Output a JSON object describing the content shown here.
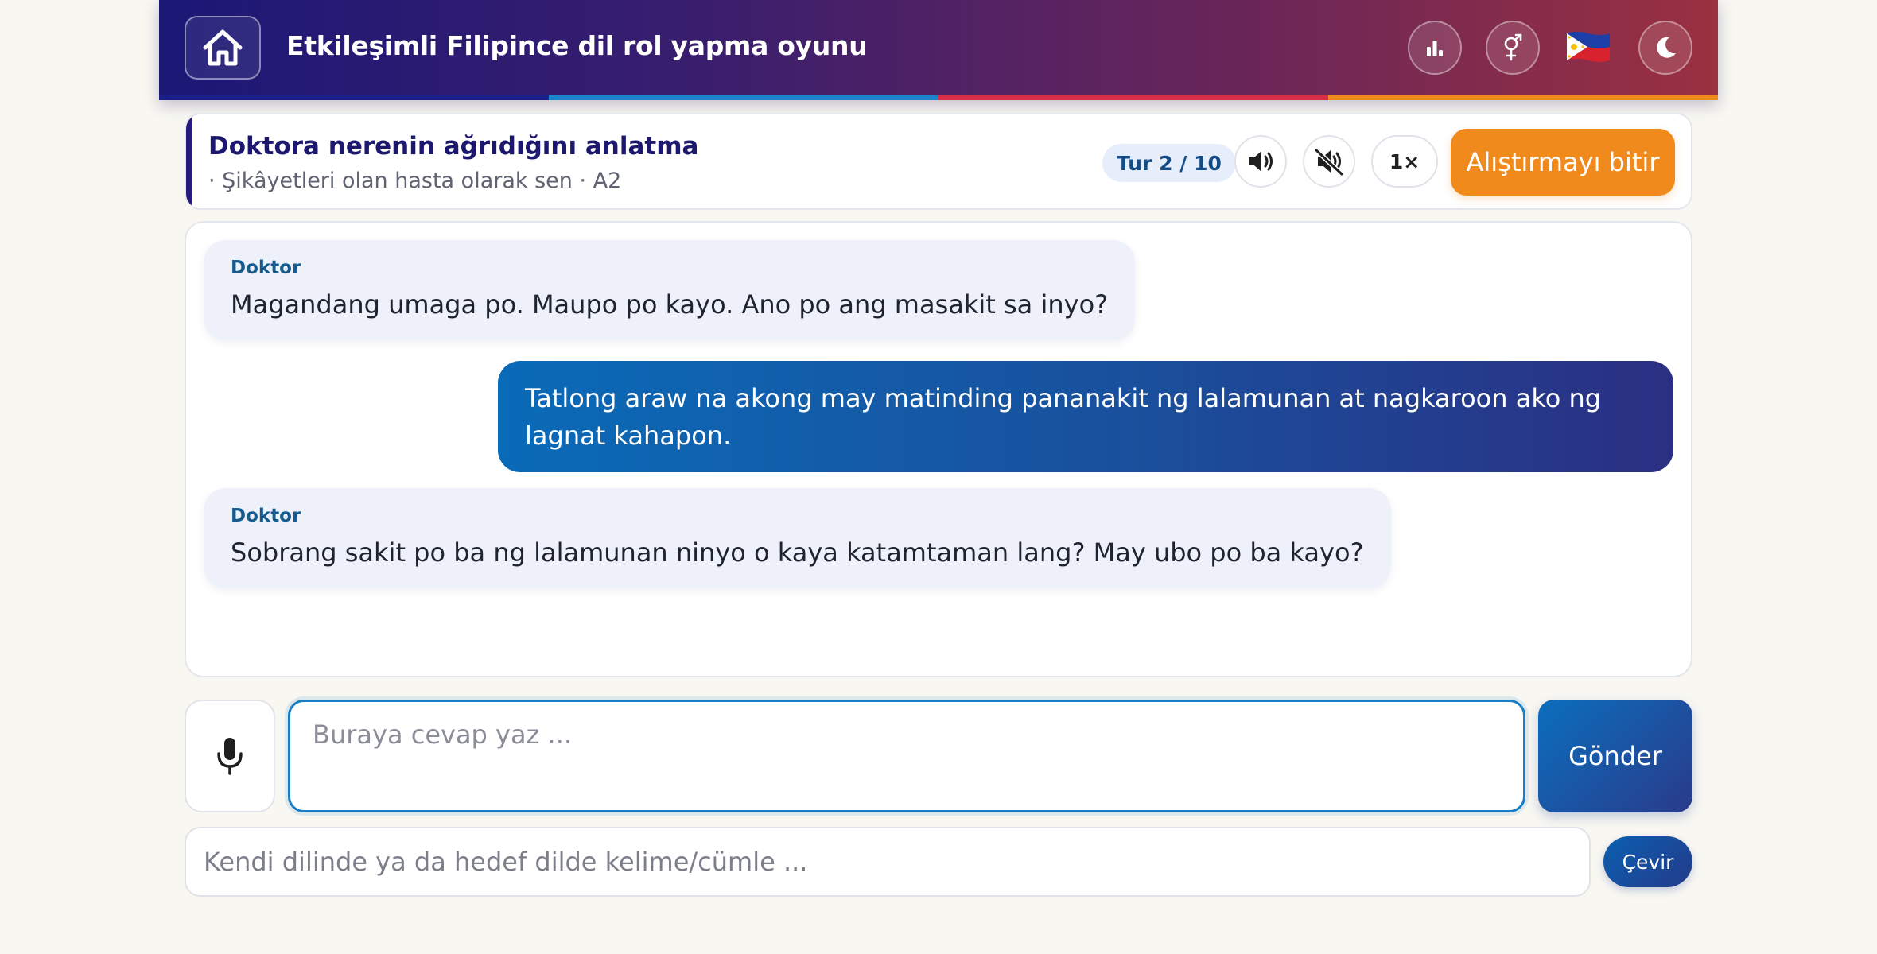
{
  "header": {
    "title": "Etkileşimli Filipince dil rol yapma oyunu",
    "icons": {
      "home": "home-icon",
      "stats": "bar-chart-icon",
      "gender": "gender-icon",
      "language_flag": "philippines-flag-icon",
      "theme": "moon-icon"
    },
    "stripe_colors": [
      "#1b1f8a",
      "#1a83c9",
      "#d62f45",
      "#f08a1c"
    ]
  },
  "scenario": {
    "title": "Doktora nerenin ağrıdığını anlatma",
    "subtitle": "· Şikâyetleri olan hasta olarak sen · A2",
    "turn": "Tur 2 / 10",
    "speed": "1×",
    "finish_label": "Alıştırmayı bitir",
    "icons": {
      "audio": "speaker-icon",
      "mute": "mute-icon"
    }
  },
  "chat": {
    "messages": [
      {
        "role": "bot",
        "speaker": "Doktor",
        "text": "Magandang umaga po. Maupo po kayo. Ano po ang masakit sa inyo?"
      },
      {
        "role": "user",
        "text": "Tatlong araw na akong may matinding pananakit ng lalamunan at nagkaroon ako ng lagnat kahapon."
      },
      {
        "role": "bot",
        "speaker": "Doktor",
        "text": "Sobrang sakit po ba ng lalamunan ninyo o kaya katamtaman lang? May ubo po ba kayo?"
      }
    ]
  },
  "input": {
    "reply_placeholder": "Buraya cevap yaz ...",
    "send_label": "Gönder",
    "mic_icon": "microphone-icon",
    "translate_placeholder": "Kendi dilinde ya da hedef dilde kelime/cümle ...",
    "translate_label": "Çevir"
  },
  "colors": {
    "accent_orange": "#f08a1c",
    "brand_navy": "#1c1870",
    "user_bubble": "#0a6bb8",
    "bot_bubble": "#eef1f9"
  }
}
